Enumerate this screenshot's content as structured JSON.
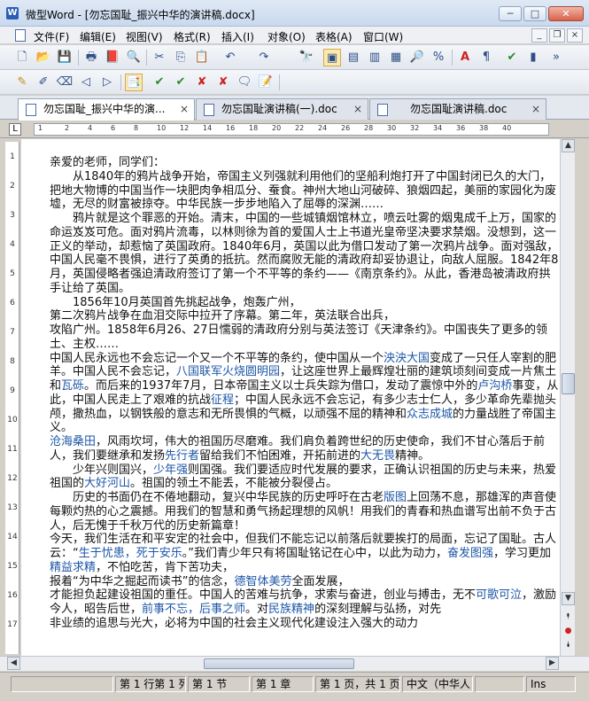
{
  "window": {
    "title": "微型Word - [勿忘国耻_振兴中华的演讲稿.docx]"
  },
  "title_buttons": {
    "minimize": "─",
    "maximize": "□",
    "close": "✕"
  },
  "menu": {
    "items": [
      "文件(F)",
      "编辑(E)",
      "视图(V)",
      "格式(R)",
      "插入(I)",
      "对象(O)",
      "表格(A)",
      "窗口(W)"
    ],
    "mdi": {
      "minimize": "_",
      "restore": "❐",
      "close": "×"
    }
  },
  "toolbar1": [
    {
      "name": "new-doc-icon",
      "glyph": "🗋"
    },
    {
      "name": "open-folder-icon",
      "glyph": "📂"
    },
    {
      "name": "save-icon",
      "glyph": "💾"
    },
    {
      "name": "print-icon",
      "glyph": "🖶"
    },
    {
      "name": "pdf-icon",
      "glyph": "📕"
    },
    {
      "name": "print-preview-icon",
      "glyph": "🔍"
    },
    {
      "name": "cut-icon",
      "glyph": "✂"
    },
    {
      "name": "copy-icon",
      "glyph": "⎘"
    },
    {
      "name": "paste-icon",
      "glyph": "📋"
    },
    {
      "name": "undo-icon",
      "glyph": "↶"
    },
    {
      "name": "redo-icon",
      "glyph": "↷"
    },
    {
      "name": "find-icon",
      "glyph": "🔭"
    },
    {
      "name": "page-view-icon",
      "glyph": "▣"
    },
    {
      "name": "web-view-icon",
      "glyph": "▤"
    },
    {
      "name": "outline-view-icon",
      "glyph": "▥"
    },
    {
      "name": "draft-view-icon",
      "glyph": "▦"
    },
    {
      "name": "zoom-icon",
      "glyph": "🔎"
    },
    {
      "name": "percent-icon",
      "glyph": "%"
    },
    {
      "name": "font-color-icon",
      "glyph": "A"
    },
    {
      "name": "format-icon",
      "glyph": "¶"
    },
    {
      "name": "spellcheck-icon",
      "glyph": "✔"
    },
    {
      "name": "stats-icon",
      "glyph": "▮"
    },
    {
      "name": "more-icon",
      "glyph": "»"
    }
  ],
  "toolbar2": [
    {
      "name": "new-note-icon",
      "glyph": "✎"
    },
    {
      "name": "edit-note-icon",
      "glyph": "✐"
    },
    {
      "name": "delete-note-icon",
      "glyph": "⌫"
    },
    {
      "name": "prev-note-icon",
      "glyph": "◁"
    },
    {
      "name": "next-note-icon",
      "glyph": "▷"
    },
    {
      "name": "track-changes-icon",
      "glyph": "📑"
    },
    {
      "name": "accept-icon",
      "glyph": "✔"
    },
    {
      "name": "accept-all-icon",
      "glyph": "✔"
    },
    {
      "name": "reject-icon",
      "glyph": "✘"
    },
    {
      "name": "reject-all-icon",
      "glyph": "✘"
    },
    {
      "name": "comment-icon",
      "glyph": "🗨"
    },
    {
      "name": "review-pane-icon",
      "glyph": "📝"
    }
  ],
  "tabs": [
    {
      "label": "勿忘国耻_振兴中华的演...",
      "close": "×"
    },
    {
      "label": "勿忘国耻演讲稿(一).doc",
      "close": "×"
    },
    {
      "label": "勿忘国耻演讲稿.doc",
      "close": "×"
    }
  ],
  "ruler": {
    "h": [
      "1",
      "2",
      "4",
      "6",
      "8",
      "10",
      "12",
      "14",
      "16",
      "18",
      "20",
      "22",
      "24",
      "26",
      "28",
      "30",
      "32",
      "34",
      "36",
      "38",
      "40"
    ],
    "v": [
      "1",
      "2",
      "3",
      "4",
      "5",
      "6",
      "7",
      "8",
      "9",
      "10",
      "11",
      "12",
      "13",
      "14",
      "15",
      "16",
      "17"
    ]
  },
  "document": {
    "p1": "亲爱的老师，同学们：",
    "p2": "　　从1840年的鸦片战争开始，帝国主义列强就利用他们的坚船利炮打开了中国封闭已久的大门，把地大物博的中国当作一块肥肉争相瓜分、蚕食。神州大地山河破碎、狼烟四起，美丽的家园化为废墟，无尽的财富被掠夺。中华民族一步步地陷入了屈辱的深渊……",
    "p3": "　　鸦片就是这个罪恶的开始。清末，中国的一些城镇烟馆林立，喷云吐雾的烟鬼成千上万，国家的命运岌岌可危。面对鸦片流毒，以林则徐为首的爱国人士上书道光皇帝坚决要求禁烟。没想到，这一正义的举动，却惹恼了英国政府。1840年6月，英国以此为借口发动了第一次鸦片战争。面对强敌，中国人民毫不畏惧，进行了英勇的抵抗。然而腐败无能的清政府却妥协退让，向敌人屈服。1842年8月，英国侵略者强迫清政府签订了第一个不平等的条约——《南京条约》。从此，香港岛被清政府拱手让给了英国。",
    "p4": "　　1856年10月英国首先挑起战争，炮轰广州，",
    "p5": "第二次鸦片战争在血泪交际中拉开了序幕。第二年，英法联合出兵，",
    "p6": "攻陷广州。1858年6月26、27日懦弱的清政府分别与英法签订《天津条约》。中国丧失了更多的领土、主权……",
    "p7a": "中国人民永远也不会忘记一个又一个不平等的条约，使中国从一个",
    "p7b": "泱泱大国",
    "p7c": "变成了一只任人宰割的肥羊。中国人民不会忘记，",
    "p7d": "八国联军火烧圆明园",
    "p7e": "，让这座世界上最辉煌壮丽的建筑顷刻间变成一片焦土和",
    "p7f": "瓦砾",
    "p7g": "。而后来的1937年7月，日本帝国主义以士兵失踪为借口，发动了震惊中外的",
    "p7h": "卢沟桥",
    "p7i": "事变，从此，中国人民走上了艰难的抗战",
    "p7j": "征程",
    "p7k": "；中国人民永远不会忘记，有多少志士仁人，多少革命先辈抛头颅，撒热血，以钢铁般的意志和无所畏惧的气概，以顽强不屈的精神和",
    "p7l": "众志成城",
    "p7m": "的力量战胜了帝国主义。",
    "p8a": "沧海桑田",
    "p8b": "，风雨坎坷，伟大的祖国历尽磨难。我们肩负着跨世纪的历史使命，我们不甘心落后于前人，我们要继承和发扬",
    "p8c": "先行者",
    "p8d": "留给我们不怕困难，开拓前进的",
    "p8e": "大无畏",
    "p8f": "精神。",
    "p9a": "　　少年兴则国兴，",
    "p9b": "少年强",
    "p9c": "则国强。我们要适应时代发展的要求，正确认识祖国的历史与未来，热爱祖国的",
    "p9d": "大好河山",
    "p9e": "。祖国的领土不能丢，不能被分裂侵占。",
    "p10a": "　　历史的书面仍在不倦地翻动，复兴中华民族的历史呼吁在古老",
    "p10b": "版图",
    "p10c": "上回荡不息，那雄浑的声音使每颗灼热的心之震撼。用我们的智慧和勇气扬起理想的风帆！用我们的青春和热血谱写出前不负于古人，后无愧于千秋万代的历史新篇章！",
    "p11a": "今天，我们生活在和平安定的社会中，但我们不能忘记以前落后就要挨打的局面，忘记了国耻。古人云：“",
    "p11b": "生于忧患，死于安乐",
    "p11c": "。”我们青少年只有将国耻铭记在心中，以此为动力，",
    "p11d": "奋发图强",
    "p11e": "，学习更加",
    "p11f": "精益求精",
    "p11g": "，不怕吃苦，肯下苦功夫，",
    "p12a": "报着“为中华之掘起而读书”的信念，",
    "p12b": "德智体美劳",
    "p12c": "全面发展，",
    "p13a": "才能担负起建设祖国的重任。中国人的苦难与抗争，求索与奋进，创业与搏击，无不",
    "p13b": "可歌可泣",
    "p13c": "，激励今人，昭告后世，",
    "p13d": "前事不忘，后事之师",
    "p13e": "。对",
    "p13f": "民族精神",
    "p13g": "的深刻理解与弘扬，对先",
    "p14": "非业绩的追思与光大，必将为中国的社会主义现代化建设注入强大的动力"
  },
  "scrollbar": {
    "up": "▲",
    "down": "▼",
    "prev_page": "⯭",
    "select": "●",
    "next_page": "⯯",
    "left": "◀",
    "right": "▶"
  },
  "status": {
    "page_line": "第 1 行第 1 列",
    "section": "第 1 节",
    "chapter": "第 1 章",
    "page_of": "第 1 页，共 1 页",
    "language": "中文（中华人",
    "mode": "Ins"
  }
}
